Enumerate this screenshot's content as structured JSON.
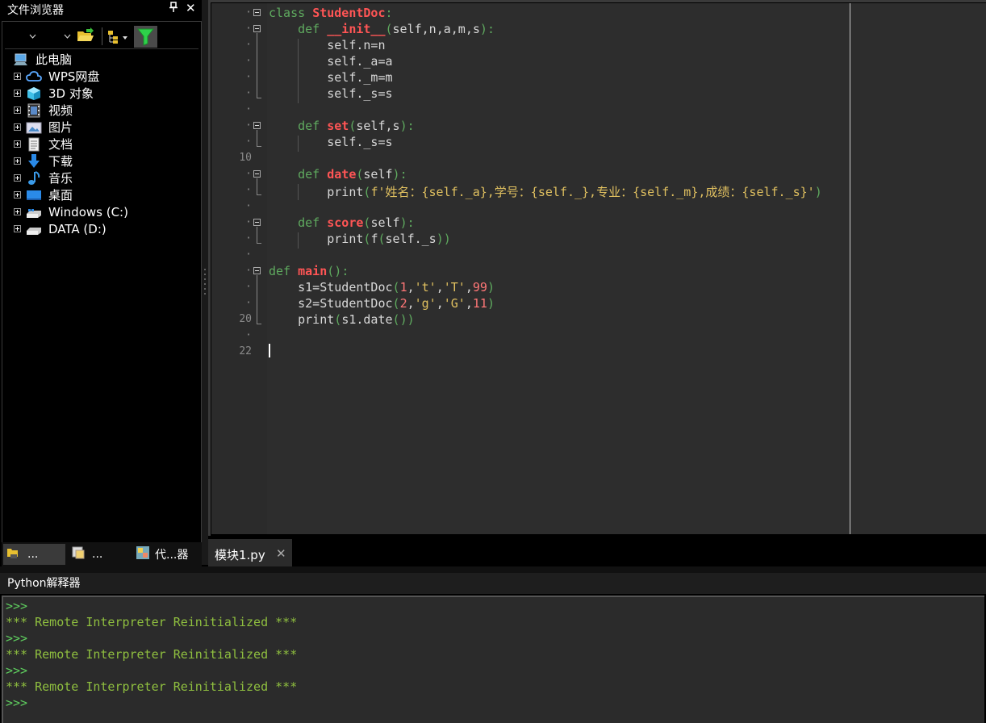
{
  "file_browser": {
    "title": "文件浏览器",
    "pin_glyph": "ᚹ",
    "close_glyph": "✕",
    "tree_root": "此电脑",
    "tree_items": [
      {
        "label": "WPS网盘",
        "icon": "cloud-icon"
      },
      {
        "label": "3D 对象",
        "icon": "cube-icon"
      },
      {
        "label": "视频",
        "icon": "video-icon"
      },
      {
        "label": "图片",
        "icon": "picture-icon"
      },
      {
        "label": "文档",
        "icon": "document-icon"
      },
      {
        "label": "下载",
        "icon": "download-icon"
      },
      {
        "label": "音乐",
        "icon": "music-icon"
      },
      {
        "label": "桌面",
        "icon": "desktop-icon"
      },
      {
        "label": "Windows (C:)",
        "icon": "drive-icon"
      },
      {
        "label": "DATA (D:)",
        "icon": "drive-icon"
      }
    ],
    "bottom_tabs": [
      "...",
      "...",
      "代...器"
    ]
  },
  "editor": {
    "tab_label": "模块1.py",
    "tab_close": "✕",
    "line_markers": [
      {
        "text": "·"
      },
      {
        "text": "·"
      },
      {
        "text": "·"
      },
      {
        "text": "·"
      },
      {
        "text": "·"
      },
      {
        "text": "·"
      },
      {
        "text": "·"
      },
      {
        "text": "·"
      },
      {
        "text": "·"
      },
      {
        "text": "10"
      },
      {
        "text": "·"
      },
      {
        "text": "·"
      },
      {
        "text": "·"
      },
      {
        "text": "·"
      },
      {
        "text": "·"
      },
      {
        "text": "·"
      },
      {
        "text": "·"
      },
      {
        "text": "·"
      },
      {
        "text": "·"
      },
      {
        "text": "20"
      },
      {
        "text": "·"
      },
      {
        "text": "22"
      }
    ],
    "code_lines": [
      "class StudentDoc:",
      "    def __init__(self,n,a,m,s):",
      "        self.n=n",
      "        self._a=a",
      "        self._m=m",
      "        self._s=s",
      "",
      "    def set(self,s):",
      "        self._s=s",
      "",
      "    def date(self):",
      "        print(f'姓名：{self._a},学号：{self._},专业：{self._m},成绩：{self._s}')",
      "",
      "    def score(self):",
      "        print(f(self._s))",
      "",
      "def main():",
      "    s1=StudentDoc(1,'t','T',99)",
      "    s2=StudentDoc(2,'g','G',11)",
      "    print(s1.date())",
      "",
      ""
    ]
  },
  "interpreter": {
    "title": "Python解释器",
    "lines": [
      ">>>",
      "*** Remote Interpreter Reinitialized ***",
      ">>>",
      "*** Remote Interpreter Reinitialized ***",
      ">>>",
      "*** Remote Interpreter Reinitialized ***",
      ">>>"
    ]
  },
  "colors": {
    "keyword": "#5faa5f",
    "function": "#ff5555",
    "string": "#e0c060",
    "prompt": "#5fcf5f"
  }
}
